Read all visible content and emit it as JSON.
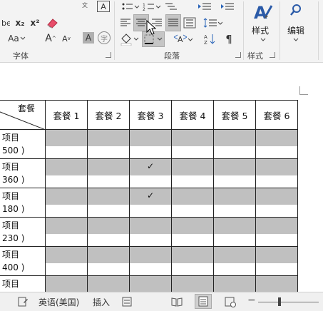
{
  "ribbon": {
    "groups": {
      "font": "字体",
      "paragraph": "段落",
      "styles": "样式"
    },
    "font_group": {
      "subscript": "x₂",
      "superscript": "x²",
      "font_size_label": "Aa",
      "grow_font": "A",
      "shrink_font": "A",
      "char_shading": "A",
      "char_border": "字"
    },
    "styles_button": "样式",
    "edit_button": "编辑"
  },
  "table": {
    "corner_label": "套餐",
    "columns": [
      "套餐 1",
      "套餐 2",
      "套餐 3",
      "套餐 4",
      "套餐 5",
      "套餐 6"
    ],
    "rows": [
      {
        "name": "项目",
        "price": "500 )",
        "checks": [
          "",
          "",
          "",
          "",
          "",
          ""
        ]
      },
      {
        "name": "项目",
        "price": "360 )",
        "checks": [
          "",
          "",
          "✓",
          "",
          "",
          ""
        ]
      },
      {
        "name": "项目",
        "price": "180 )",
        "checks": [
          "",
          "",
          "✓",
          "",
          "",
          ""
        ]
      },
      {
        "name": "项目",
        "price": "230 )",
        "checks": [
          "",
          "",
          "",
          "",
          "",
          ""
        ]
      },
      {
        "name": "项目",
        "price": "400 )",
        "checks": [
          "",
          "",
          "",
          "",
          "",
          ""
        ]
      },
      {
        "name": "项目",
        "price": "",
        "checks": [
          "",
          "",
          "",
          "",
          "",
          ""
        ]
      }
    ]
  },
  "statusbar": {
    "language": "英语(美国)",
    "insert_mode": "插入"
  }
}
